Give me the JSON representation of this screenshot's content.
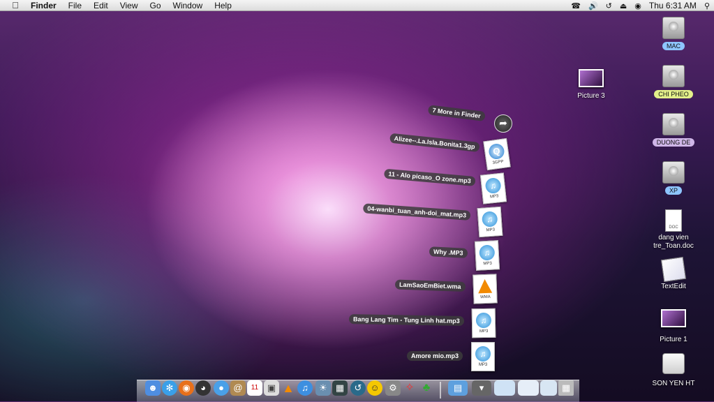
{
  "menubar": {
    "app_name": "Finder",
    "menus": [
      "File",
      "Edit",
      "View",
      "Go",
      "Window",
      "Help"
    ],
    "clock": "Thu 6:31 AM"
  },
  "desktop": {
    "items": [
      {
        "label": "MAC",
        "pill_color": "#8ec5ff"
      },
      {
        "label": "CHI PHEO",
        "pill_color": "#e3f08a"
      },
      {
        "label": "DUONG DE",
        "pill_color": "#cfb6e8"
      },
      {
        "label": "XP",
        "pill_color": "#8ec5ff"
      },
      {
        "label": "dang vien tre_Toan.doc"
      },
      {
        "label": "TextEdit"
      },
      {
        "label": "Picture 1"
      },
      {
        "label": "SON YEN HT"
      },
      {
        "label": "Picture 3"
      }
    ]
  },
  "stack": {
    "more_label": "7 More in Finder",
    "files": [
      {
        "name": "Alizee--.La.Isla.Bonita1.3gp",
        "type": "3GPP"
      },
      {
        "name": "11 - Alo picaso_O zone.mp3",
        "type": "MP3"
      },
      {
        "name": "04-wanbi_tuan_anh-doi_mat.mp3",
        "type": "MP3"
      },
      {
        "name": "Why .MP3",
        "type": "MP3"
      },
      {
        "name": "LamSaoEmBiet.wma",
        "type": "WMA"
      },
      {
        "name": "Bang Lang Tim - Tung Linh hat.mp3",
        "type": "MP3"
      },
      {
        "name": "Amore mio.mp3",
        "type": "MP3"
      }
    ]
  },
  "dock": {
    "apps": [
      "finder-icon",
      "safari-icon",
      "firefox-icon",
      "dashboard-icon",
      "ichat-icon",
      "address-book-icon",
      "ical-icon",
      "preview-icon",
      "vlc-icon",
      "itunes-icon",
      "iphoto-icon",
      "spaces-icon",
      "time-machine-icon",
      "yahoo-messenger-icon",
      "system-preferences-icon",
      "flash-icon",
      "frog-icon"
    ],
    "right_items": [
      "applications-folder-icon",
      "downloads-stack-icon",
      "window-thumbnail-icon",
      "window-thumbnail-icon",
      "window-thumbnail-icon",
      "trash-icon"
    ]
  }
}
